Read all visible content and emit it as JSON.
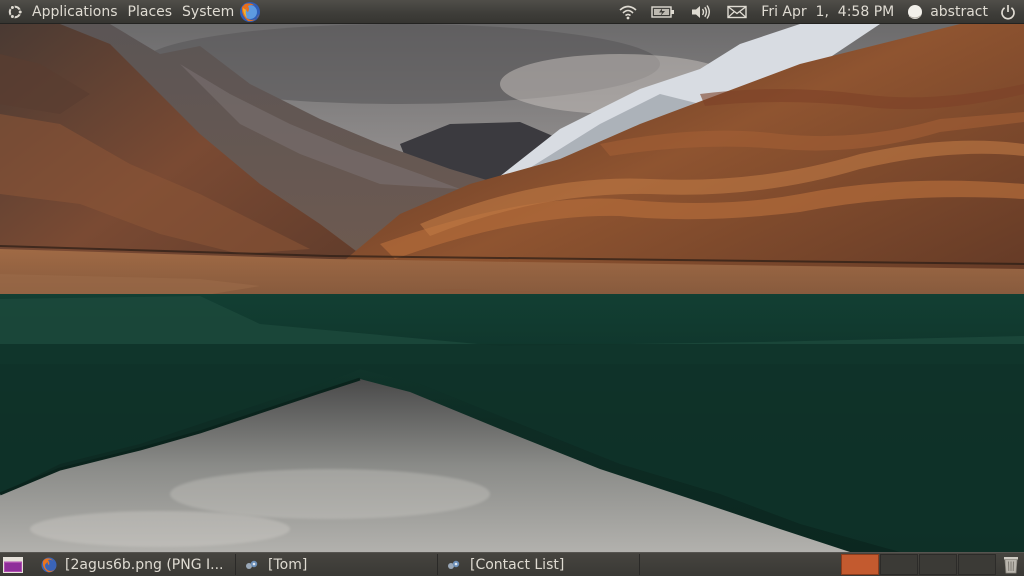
{
  "top_panel": {
    "menus": {
      "applications": "Applications",
      "places": "Places",
      "system": "System"
    },
    "clock": "Fri Apr  1,  4:58 PM",
    "user": "abstract"
  },
  "taskbar": {
    "tasks": [
      {
        "label": "[2agus6b.png (PNG I...",
        "icon": "firefox-icon"
      },
      {
        "label": "[Tom]",
        "icon": "chat-icon"
      },
      {
        "label": "[Contact List]",
        "icon": "chat-icon"
      }
    ],
    "workspaces": {
      "count": 4,
      "active_index": 0
    }
  },
  "icons": {
    "top": [
      "ubuntu-logo-icon",
      "firefox-icon",
      "wifi-icon",
      "battery-icon",
      "volume-icon",
      "mail-icon",
      "user-status-icon",
      "power-icon"
    ],
    "bottom": [
      "show-desktop-icon",
      "trash-icon"
    ]
  },
  "colors": {
    "panel": "#3f3e3a",
    "panel_text": "#dfdbd2",
    "active_workspace": "#c35a2f"
  }
}
